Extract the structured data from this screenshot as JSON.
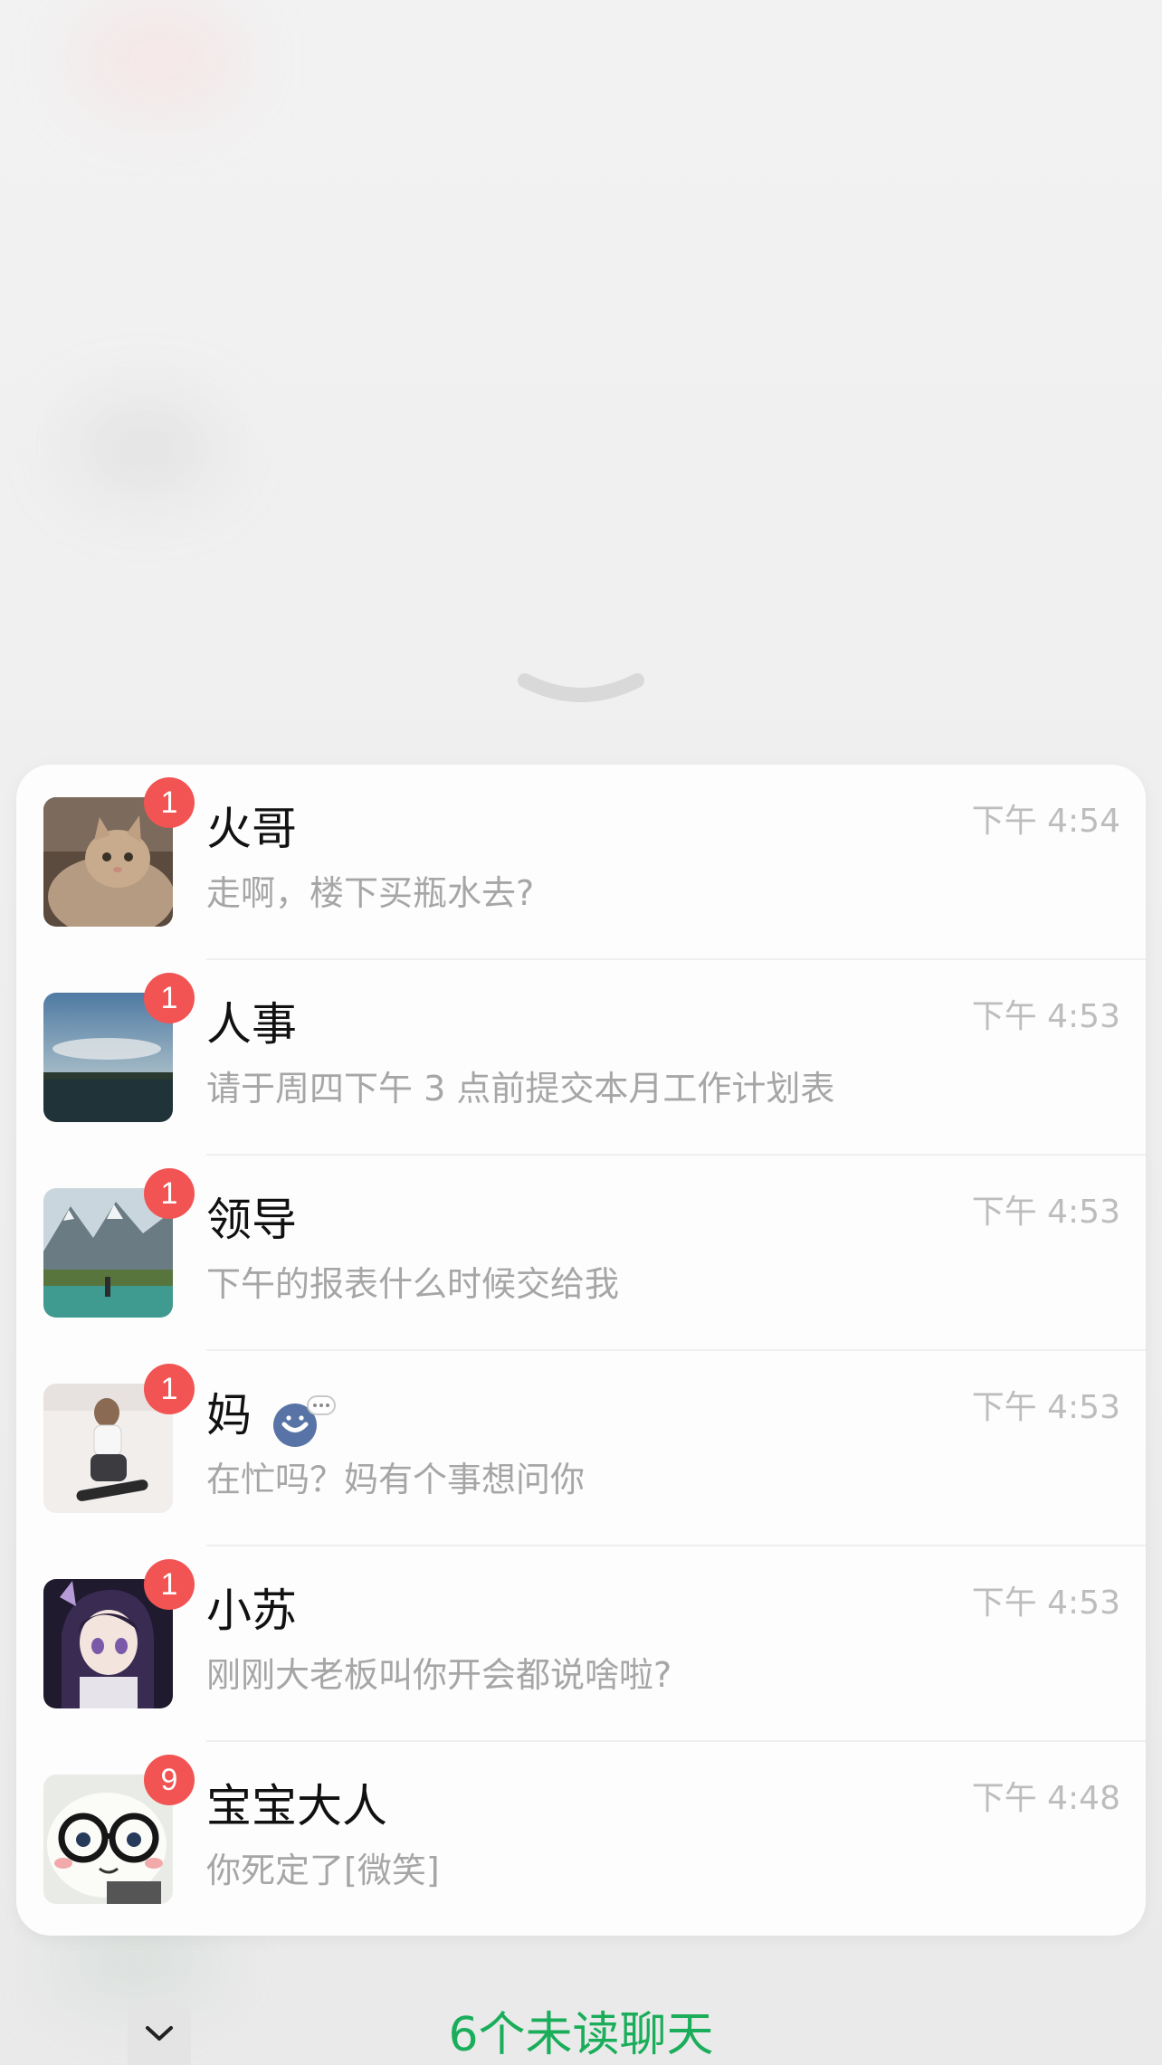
{
  "chats": [
    {
      "name": "火哥",
      "preview": "走啊，楼下买瓶水去?",
      "time": "下午 4:54",
      "unread": "1",
      "avatar": "cat-photo"
    },
    {
      "name": "人事",
      "preview": "请于周四下午 3 点前提交本月工作计划表",
      "time": "下午 4:53",
      "unread": "1",
      "avatar": "lake-sunset-photo"
    },
    {
      "name": "领导",
      "preview": "下午的报表什么时候交给我",
      "time": "下午 4:53",
      "unread": "1",
      "avatar": "mountain-lake-photo"
    },
    {
      "name": "妈",
      "preview": "在忙吗？妈有个事想问你",
      "time": "下午 4:53",
      "unread": "1",
      "avatar": "snowboarder-photo",
      "status_icon": "smile-chat-icon"
    },
    {
      "name": "小苏",
      "preview": "刚刚大老板叫你开会都说啥啦?",
      "time": "下午 4:53",
      "unread": "1",
      "avatar": "anime-girl"
    },
    {
      "name": "宝宝大人",
      "preview": "你死定了[微笑]",
      "time": "下午 4:48",
      "unread": "9",
      "avatar": "glasses-cat-cartoon"
    }
  ],
  "footer": {
    "label": "6个未读聊天"
  },
  "colors": {
    "badge": "#f25453",
    "footer_text": "#1aad5a",
    "time": "#bdbdbd",
    "preview": "#a6a6a6"
  }
}
